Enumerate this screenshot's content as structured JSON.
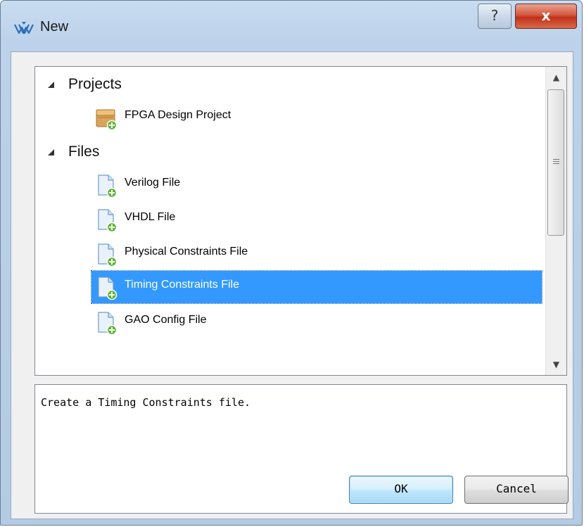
{
  "window": {
    "title": "New",
    "help_glyph": "?",
    "close_glyph": "x"
  },
  "tree": {
    "categories": [
      {
        "label": "Projects",
        "expanded": true
      },
      {
        "label": "Files",
        "expanded": true
      }
    ],
    "items": [
      {
        "label": "FPGA Design Project",
        "icon": "project-box-icon"
      },
      {
        "label": "Verilog File",
        "icon": "new-file-icon"
      },
      {
        "label": "VHDL File",
        "icon": "new-file-icon"
      },
      {
        "label": "Physical Constraints File",
        "icon": "new-file-icon"
      },
      {
        "label": "Timing Constraints File",
        "icon": "new-file-icon",
        "selected": true
      },
      {
        "label": "GAO Config File",
        "icon": "new-file-icon"
      }
    ]
  },
  "description": "Create a Timing Constraints file.",
  "buttons": {
    "ok": "OK",
    "cancel": "Cancel"
  },
  "colors": {
    "selection": "#3399ff",
    "plus_badge": "#5cb531"
  }
}
